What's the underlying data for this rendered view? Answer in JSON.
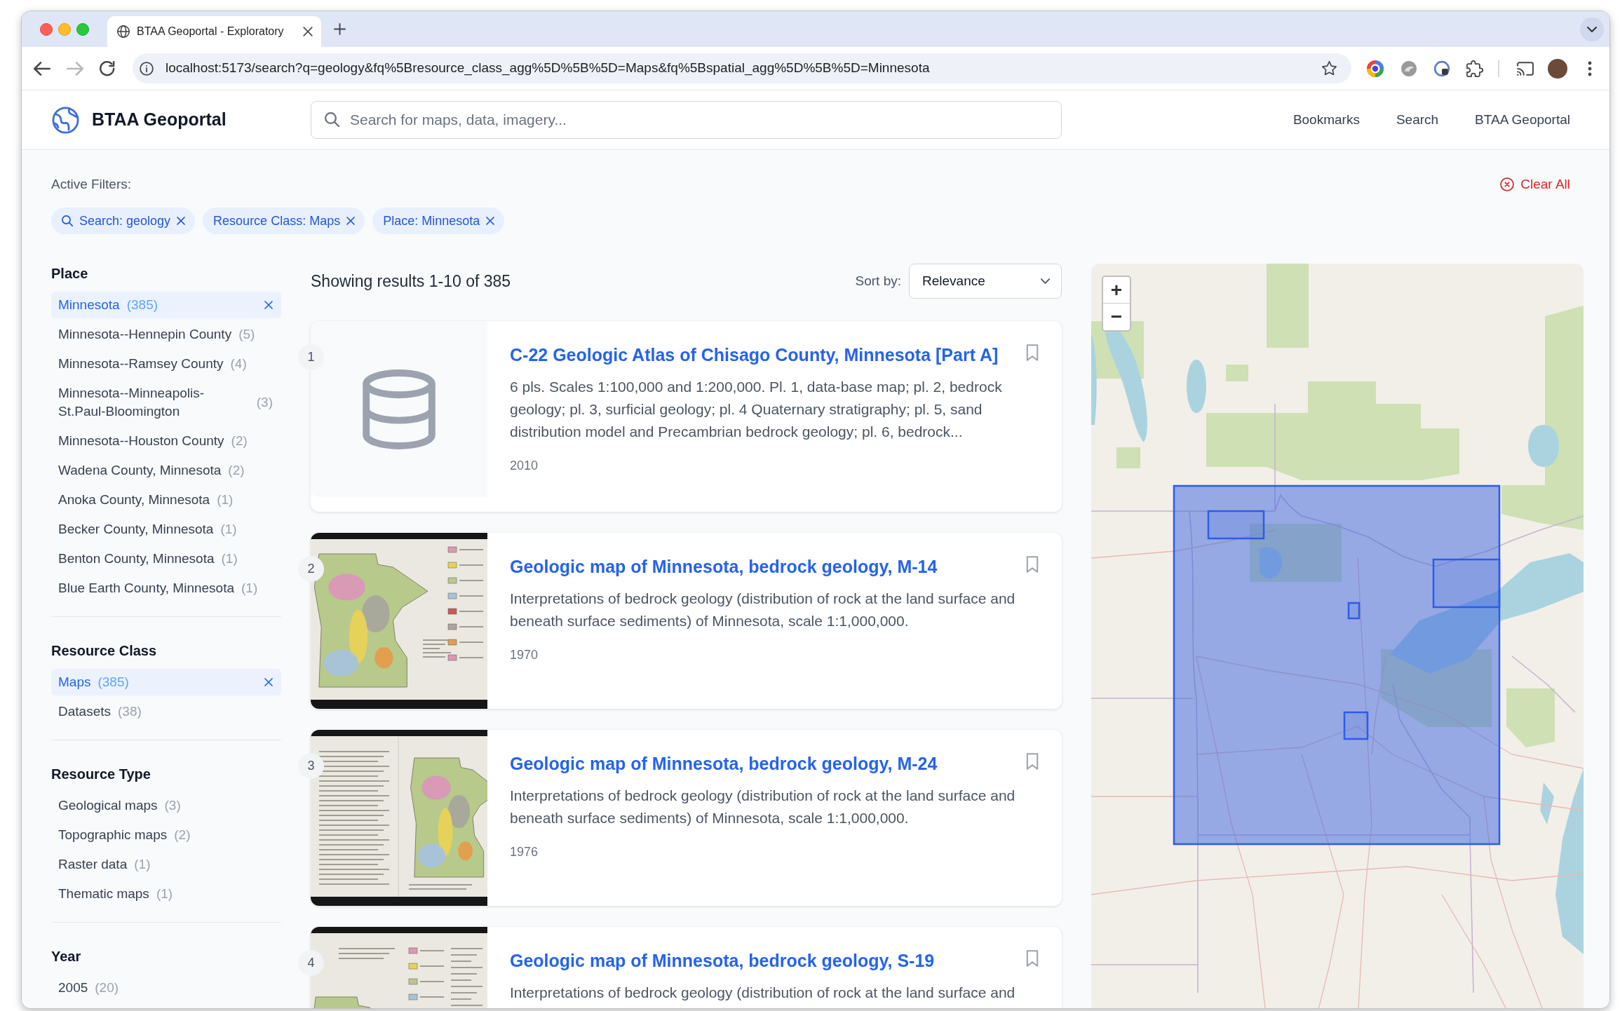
{
  "browser": {
    "tab_title": "BTAA Geoportal - Exploratory",
    "url": "localhost:5173/search?q=geology&fq%5Bresource_class_agg%5D%5B%5D=Maps&fq%5Bspatial_agg%5D%5B%5D=Minnesota"
  },
  "header": {
    "logo_text": "BTAA Geoportal",
    "search": {
      "placeholder": "Search for maps, data, imagery..."
    },
    "nav": [
      "Bookmarks",
      "Search",
      "BTAA Geoportal"
    ]
  },
  "active_filters": {
    "label": "Active Filters:",
    "clear_all": "Clear All",
    "chips": [
      {
        "kind": "query",
        "label": "Search: geology"
      },
      {
        "kind": "facet",
        "label": "Resource Class: Maps"
      },
      {
        "kind": "facet",
        "label": "Place: Minnesota"
      }
    ]
  },
  "facets": [
    {
      "title": "Place",
      "items": [
        {
          "label": "Minnesota",
          "count": "(385)",
          "selected": true
        },
        {
          "label": "Minnesota--Hennepin County",
          "count": "(5)",
          "selected": false
        },
        {
          "label": "Minnesota--Ramsey County",
          "count": "(4)",
          "selected": false
        },
        {
          "label": "Minnesota--Minneapolis-St.Paul-Bloomington",
          "count": "(3)",
          "selected": false
        },
        {
          "label": "Minnesota--Houston County",
          "count": "(2)",
          "selected": false
        },
        {
          "label": "Wadena County, Minnesota",
          "count": "(2)",
          "selected": false
        },
        {
          "label": "Anoka County, Minnesota",
          "count": "(1)",
          "selected": false
        },
        {
          "label": "Becker County, Minnesota",
          "count": "(1)",
          "selected": false
        },
        {
          "label": "Benton County, Minnesota",
          "count": "(1)",
          "selected": false
        },
        {
          "label": "Blue Earth County, Minnesota",
          "count": "(1)",
          "selected": false
        }
      ]
    },
    {
      "title": "Resource Class",
      "items": [
        {
          "label": "Maps",
          "count": "(385)",
          "selected": true
        },
        {
          "label": "Datasets",
          "count": "(38)",
          "selected": false
        }
      ]
    },
    {
      "title": "Resource Type",
      "items": [
        {
          "label": "Geological maps",
          "count": "(3)",
          "selected": false
        },
        {
          "label": "Topographic maps",
          "count": "(2)",
          "selected": false
        },
        {
          "label": "Raster data",
          "count": "(1)",
          "selected": false
        },
        {
          "label": "Thematic maps",
          "count": "(1)",
          "selected": false
        }
      ]
    },
    {
      "title": "Year",
      "items": [
        {
          "label": "2005",
          "count": "(20)",
          "selected": false
        }
      ]
    }
  ],
  "results": {
    "summary": "Showing results 1-10 of 385",
    "sort_label": "Sort by:",
    "sort_value": "Relevance",
    "items": [
      {
        "number": "1",
        "kind": "no-image",
        "title": "C-22 Geologic Atlas of Chisago County, Minnesota [Part A]",
        "description": "6 pls. Scales 1:100,000 and 1:200,000. Pl. 1, data-base map; pl. 2, bedrock geology; pl. 3, surficial geology; pl. 4 Quaternary stratigraphy; pl. 5, sand distribution model and Precambrian bedrock geology; pl. 6, bedrock...",
        "year": "2010",
        "bookmarked": false
      },
      {
        "number": "2",
        "kind": "image",
        "title": "Geologic map of Minnesota, bedrock geology, M-14",
        "description": "Interpretations of bedrock geology (distribution of rock at the land surface and beneath surface sediments) of Minnesota, scale 1:1,000,000.",
        "year": "1970",
        "bookmarked": false
      },
      {
        "number": "3",
        "kind": "image",
        "title": "Geologic map of Minnesota, bedrock geology, M-24",
        "description": "Interpretations of bedrock geology (distribution of rock at the land surface and beneath surface sediments) of Minnesota, scale 1:1,000,000.",
        "year": "1976",
        "bookmarked": false
      },
      {
        "number": "4",
        "kind": "image",
        "title": "Geologic map of Minnesota, bedrock geology, S-19",
        "description": "Interpretations of bedrock geology (distribution of rock at the land surface and",
        "bookmarked": false
      }
    ]
  },
  "map": {
    "zoom_in": "+",
    "zoom_out": "−"
  }
}
